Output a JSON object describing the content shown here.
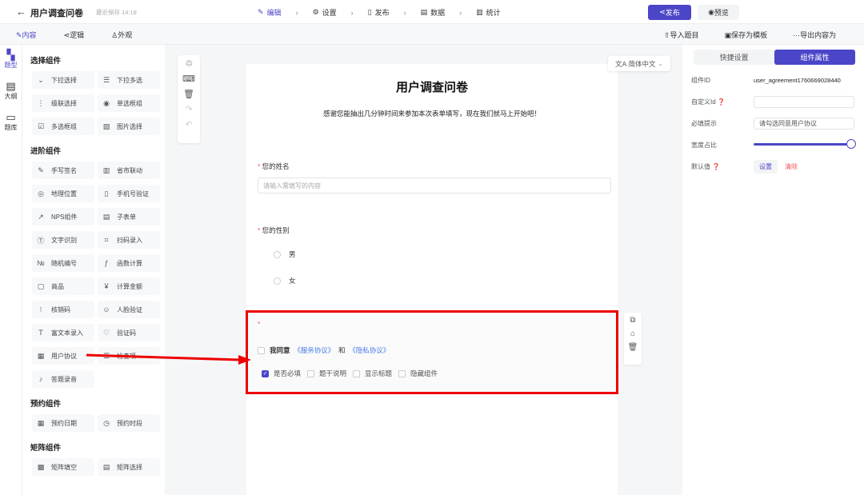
{
  "header": {
    "title": "用户调查问卷",
    "save_status": "最近保存 14:18",
    "steps": [
      "编辑",
      "设置",
      "发布",
      "数据",
      "统计"
    ],
    "publish": "发布",
    "preview": "预览"
  },
  "subbar": {
    "tabs": [
      "内容",
      "逻辑",
      "外观"
    ],
    "actions": [
      "导入题目",
      "保存为模板",
      "导出内容为"
    ]
  },
  "rail": [
    "题型",
    "大纲",
    "题库"
  ],
  "components": {
    "sections": [
      {
        "title": "选择组件",
        "items": [
          [
            "⌄",
            "下拉选择"
          ],
          [
            "☰",
            "下拉多选"
          ],
          [
            "⋮",
            "级联选择"
          ],
          [
            "◉",
            "单选框组"
          ],
          [
            "☑",
            "多选框组"
          ],
          [
            "▨",
            "图片选择"
          ]
        ]
      },
      {
        "title": "进阶组件",
        "items": [
          [
            "✎",
            "手写签名"
          ],
          [
            "▥",
            "省市联动"
          ],
          [
            "◎",
            "地理位置"
          ],
          [
            "▯",
            "手机号验证"
          ],
          [
            "↗",
            "NPS组件"
          ],
          [
            "▤",
            "子表单"
          ],
          [
            "Ⓣ",
            "文字识别"
          ],
          [
            "⌗",
            "扫码录入"
          ],
          [
            "№",
            "随机编号"
          ],
          [
            "ƒ",
            "函数计算"
          ],
          [
            "▢",
            "商品"
          ],
          [
            "¥",
            "计算金额"
          ],
          [
            "⁝",
            "核销码"
          ],
          [
            "☺",
            "人脸验证"
          ],
          [
            "T",
            "富文本录入"
          ],
          [
            "♡",
            "验证码"
          ],
          [
            "▦",
            "用户协议"
          ],
          [
            "☰",
            "检查项"
          ],
          [
            "♪",
            "答题录音"
          ]
        ]
      },
      {
        "title": "预约组件",
        "items": [
          [
            "▦",
            "预约日期"
          ],
          [
            "◷",
            "预约时段"
          ]
        ]
      },
      {
        "title": "矩阵组件",
        "items": [
          [
            "▩",
            "矩阵填空"
          ],
          [
            "▤",
            "矩阵选择"
          ]
        ]
      }
    ]
  },
  "canvas": {
    "language": "简体中文",
    "form_title": "用户调查问卷",
    "form_desc": "感谢您能抽出几分钟时间来参加本次表单填写，现在我们就马上开始吧！",
    "q1": {
      "label": "您的姓名",
      "placeholder": "请输入需填写的内容"
    },
    "q2": {
      "label": "您的性别",
      "options": [
        "男",
        "女"
      ]
    },
    "q3": {
      "prefix": "我同意",
      "link1": "《服务协议》",
      "and": "和",
      "link2": "《隐私协议》",
      "toggles": [
        {
          "label": "是否必填",
          "checked": true
        },
        {
          "label": "题干说明",
          "checked": false
        },
        {
          "label": "显示标题",
          "checked": false
        },
        {
          "label": "隐藏组件",
          "checked": false
        }
      ]
    }
  },
  "props": {
    "tabs": [
      "快捷设置",
      "组件属性"
    ],
    "id_label": "组件ID",
    "id_value": "user_agreement1760669028440",
    "custom_id_label": "自定义Id",
    "required_hint_label": "必填提示",
    "required_hint_value": "请勾选同意用户协议",
    "width_label": "宽度占比",
    "width_percent": 100,
    "default_label": "默认值",
    "set": "设置",
    "clear": "清除"
  },
  "colors": {
    "accent": "#4b46c8",
    "annotation": "#e00000"
  }
}
